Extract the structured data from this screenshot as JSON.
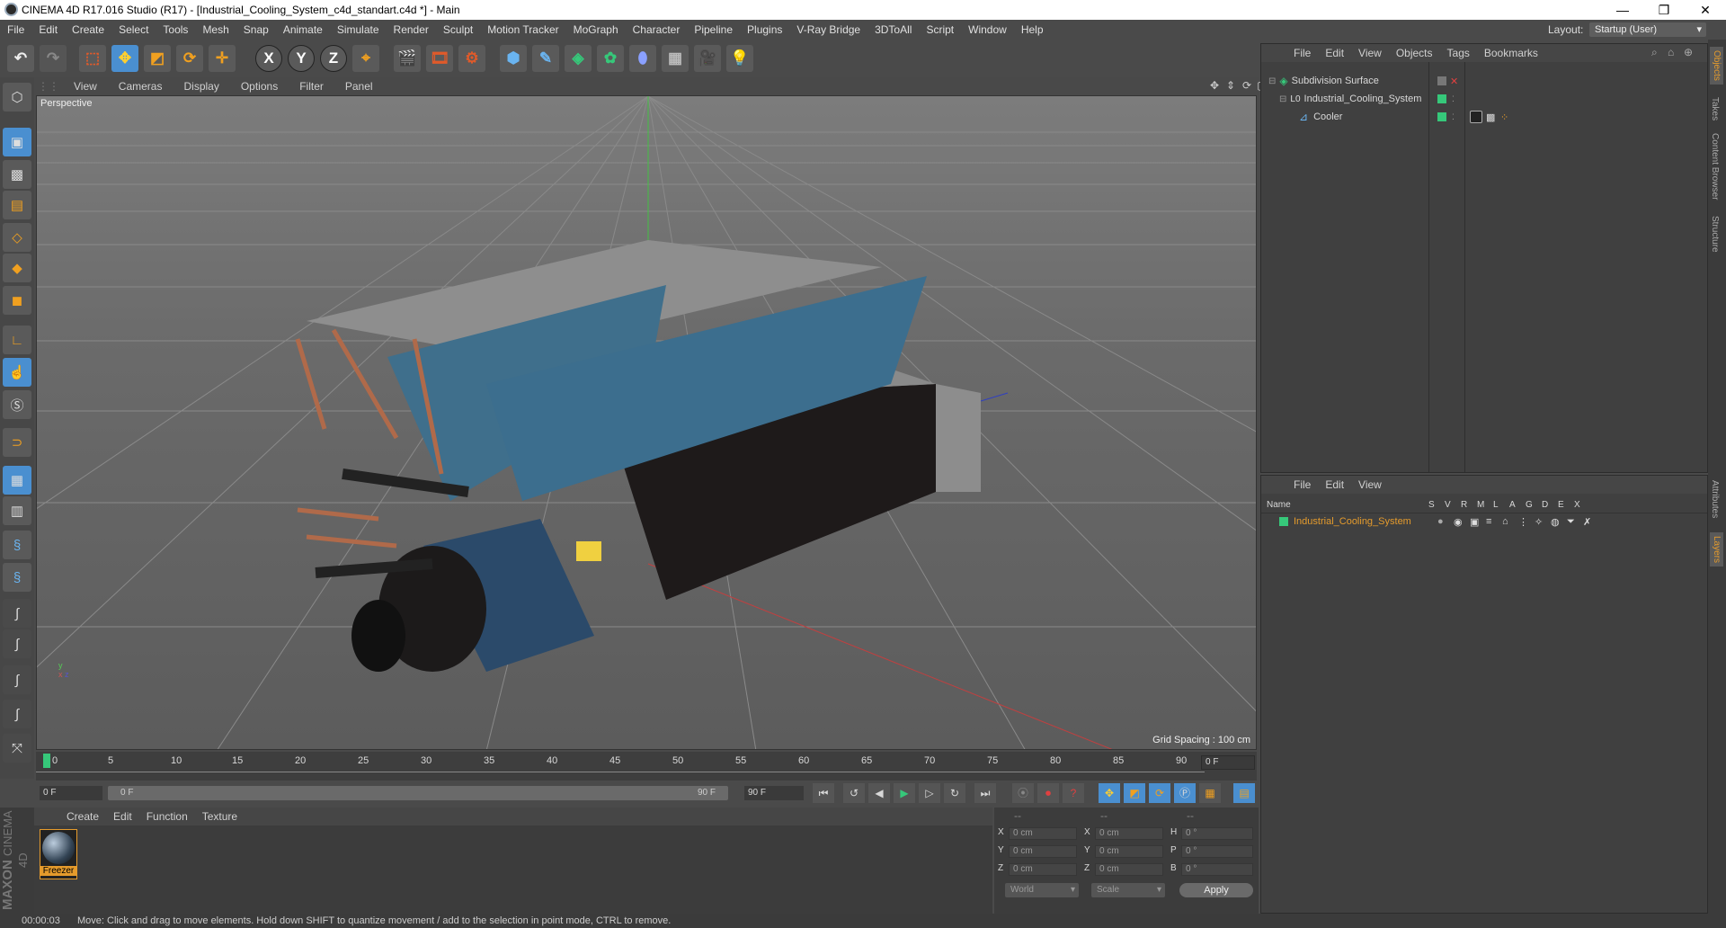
{
  "window": {
    "title": "CINEMA 4D R17.016 Studio (R17) - [Industrial_Cooling_System_c4d_standart.c4d *] - Main",
    "min": "—",
    "max": "❐",
    "close": "✕"
  },
  "menu": [
    "File",
    "Edit",
    "Create",
    "Select",
    "Tools",
    "Mesh",
    "Snap",
    "Animate",
    "Simulate",
    "Render",
    "Sculpt",
    "Motion Tracker",
    "MoGraph",
    "Character",
    "Pipeline",
    "Plugins",
    "V-Ray Bridge",
    "3DToAll",
    "Script",
    "Window",
    "Help"
  ],
  "layout": {
    "label": "Layout:",
    "value": "Startup (User)"
  },
  "toolbar": {
    "x": "X",
    "y": "Y",
    "z": "Z"
  },
  "viewport": {
    "menu": [
      "View",
      "Cameras",
      "Display",
      "Options",
      "Filter",
      "Panel"
    ],
    "label": "Perspective",
    "grid": "Grid Spacing : 100 cm"
  },
  "timeline": {
    "ticks": [
      "0",
      "5",
      "10",
      "15",
      "20",
      "25",
      "30",
      "35",
      "40",
      "45",
      "50",
      "55",
      "60",
      "65",
      "70",
      "75",
      "80",
      "85",
      "90"
    ],
    "frame_end": "0 F"
  },
  "transport": {
    "start": "0 F",
    "range_start": "0 F",
    "range_end": "90 F",
    "end": "90 F"
  },
  "materials": {
    "menu": [
      "Create",
      "Edit",
      "Function",
      "Texture"
    ],
    "items": [
      {
        "name": "Freezer"
      }
    ]
  },
  "coords": {
    "headers": [
      "--",
      "--",
      "--"
    ],
    "rows": [
      {
        "a": "X",
        "av": "0 cm",
        "b": "X",
        "bv": "0 cm",
        "c": "H",
        "cv": "0 °"
      },
      {
        "a": "Y",
        "av": "0 cm",
        "b": "Y",
        "bv": "0 cm",
        "c": "P",
        "cv": "0 °"
      },
      {
        "a": "Z",
        "av": "0 cm",
        "b": "Z",
        "bv": "0 cm",
        "c": "B",
        "cv": "0 °"
      }
    ],
    "mode1": "World",
    "mode2": "Scale",
    "apply": "Apply"
  },
  "objects": {
    "menu": [
      "File",
      "Edit",
      "View",
      "Objects",
      "Tags",
      "Bookmarks"
    ],
    "items": [
      {
        "name": "Subdivision Surface"
      },
      {
        "name": "Industrial_Cooling_System"
      },
      {
        "name": "Cooler"
      }
    ]
  },
  "layers": {
    "menu": [
      "File",
      "Edit",
      "View"
    ],
    "columns": [
      "Name",
      "S",
      "V",
      "R",
      "M",
      "L",
      "A",
      "G",
      "D",
      "E",
      "X"
    ],
    "items": [
      {
        "name": "Industrial_Cooling_System"
      }
    ]
  },
  "sidetabs": [
    "Objects",
    "Takes",
    "Content Browser",
    "Structure",
    "Attributes",
    "Layers"
  ],
  "status": {
    "time": "00:00:03",
    "message": "Move: Click and drag to move elements. Hold down SHIFT to quantize movement / add to the selection in point mode, CTRL to remove."
  },
  "brand": [
    "MAXON",
    "CINEMA 4D"
  ],
  "colors": {
    "accent": "#4a8fd0",
    "green": "#36c87a",
    "orange": "#e59b2c"
  }
}
